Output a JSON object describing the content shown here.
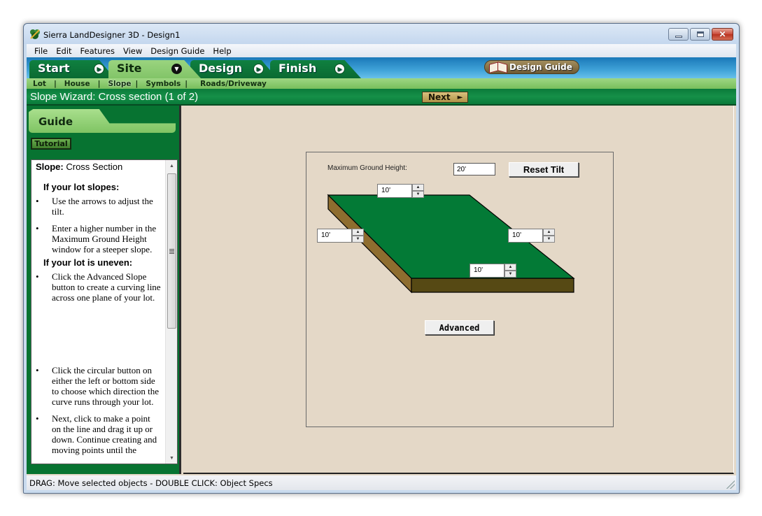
{
  "window": {
    "title": "Sierra LandDesigner 3D - Design1",
    "controls": {
      "minimize": "minimize",
      "maximize": "maximize",
      "close": "close"
    }
  },
  "menu": [
    "File",
    "Edit",
    "Features",
    "View",
    "Design Guide",
    "Help"
  ],
  "tabs": [
    {
      "label": "Start",
      "active": false,
      "arrow": "▶"
    },
    {
      "label": "Site",
      "active": true,
      "arrow": "▼"
    },
    {
      "label": "Design",
      "active": false,
      "arrow": "▶"
    },
    {
      "label": "Finish",
      "active": false,
      "arrow": "▶"
    }
  ],
  "design_guide_button": "Design Guide",
  "subnav": [
    "Lot",
    "House",
    "Slope",
    "Symbols",
    "Roads/Driveway"
  ],
  "subnav_active": "Slope",
  "wizard": {
    "title": "Slope Wizard: Cross section (1 of 2)",
    "next_label": "Next",
    "next_arrow": "►"
  },
  "guide": {
    "tab_label": "Guide",
    "tutorial_label": "Tutorial",
    "heading_bold": "Slope:",
    "heading_rest": " Cross Section",
    "section1_title": "If your lot slopes:",
    "section1_bullets": [
      "Use the arrows to adjust the tilt.",
      "Enter a higher number in the Maximum Ground Height window for a steeper slope."
    ],
    "section2_title": "If your lot is uneven:",
    "section2_bullets": [
      "Click the Advanced Slope button to create a curving line across one plane of your lot.",
      "Click the circular button on either the left or bottom side to choose which direction the curve runs through your lot.",
      "Next, click to make a point on the line and drag it up or down. Continue creating and moving points until the"
    ],
    "bullet_glyph": "•"
  },
  "slope_editor": {
    "max_ground_height_label": "Maximum Ground Height:",
    "max_ground_height_value": "20'",
    "reset_tilt_label": "Reset Tilt",
    "advanced_label": "Advanced",
    "corner_heights": {
      "top": "10'",
      "left": "10'",
      "right": "10'",
      "bottom": "10'"
    },
    "spin_up": "▲",
    "spin_down": "▼",
    "colors": {
      "surface": "#037a36",
      "side_left": "#8e6d2f",
      "side_front": "#564914",
      "outline": "#000000"
    }
  },
  "status_bar": "DRAG:  Move selected objects - DOUBLE CLICK: Object Specs"
}
